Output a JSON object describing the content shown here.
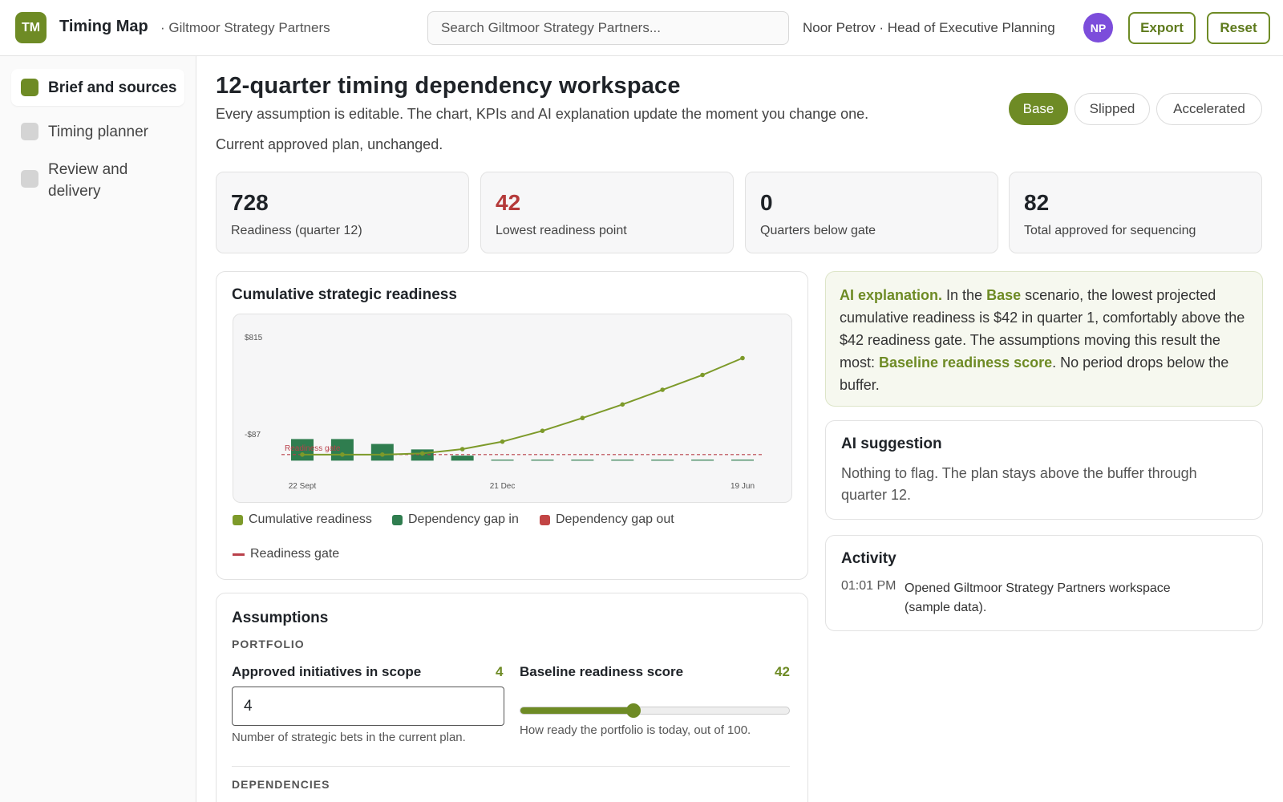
{
  "header": {
    "logo_text": "TM",
    "app_title": "Timing Map",
    "org_name": "· Giltmoor Strategy Partners",
    "search_placeholder": "Search Giltmoor Strategy Partners...",
    "user_label": "Noor Petrov · Head of Executive Planning",
    "avatar_initials": "NP",
    "export_label": "Export",
    "reset_label": "Reset"
  },
  "sidebar": {
    "items": [
      {
        "label": "Brief and sources",
        "active": true
      },
      {
        "label": "Timing planner",
        "active": false
      },
      {
        "label": "Review and delivery",
        "active": false
      }
    ]
  },
  "main": {
    "title": "12-quarter timing dependency workspace",
    "subtitle": "Every assumption is editable. The chart, KPIs and AI explanation update the moment you change one.",
    "scenario_description": "Current approved plan, unchanged.",
    "scenarios": [
      {
        "label": "Base",
        "active": true
      },
      {
        "label": "Slipped",
        "active": false
      },
      {
        "label": "Accelerated",
        "active": false
      }
    ]
  },
  "kpis": [
    {
      "value": "728",
      "label": "Readiness (quarter 12)",
      "status": "normal"
    },
    {
      "value": "42",
      "label": "Lowest readiness point",
      "status": "warning"
    },
    {
      "value": "0",
      "label": "Quarters below gate",
      "status": "normal"
    },
    {
      "value": "82",
      "label": "Total approved for sequencing",
      "status": "normal"
    }
  ],
  "chart_card": {
    "title": "Cumulative strategic readiness"
  },
  "chart_data": {
    "type": "line",
    "x_tick_labels": [
      "22 Sept",
      "21 Dec",
      "19 Jun"
    ],
    "y_tick_labels": [
      "$815",
      "-$87"
    ],
    "ylim": [
      -87,
      815
    ],
    "gate_label": "Readiness gate",
    "gate_value": 42,
    "series": [
      {
        "name": "Cumulative readiness",
        "type": "line",
        "values": [
          42,
          42,
          42,
          50,
          80,
          132,
          207,
          296,
          390,
          492,
          595,
          712
        ]
      },
      {
        "name": "Dependency gap in",
        "type": "bar",
        "values": [
          150,
          150,
          116,
          78,
          35,
          3,
          3,
          3,
          3,
          3,
          3,
          3
        ]
      },
      {
        "name": "Dependency gap out",
        "type": "bar",
        "values": [
          0,
          0,
          0,
          0,
          0,
          0,
          0,
          0,
          0,
          0,
          0,
          0
        ]
      }
    ],
    "colors": {
      "Cumulative readiness": "#7d9a2a",
      "Dependency gap in": "#2f7d4f",
      "Dependency gap out": "#c24545",
      "Readiness gate": "#b9404a"
    },
    "legend": [
      "Cumulative readiness",
      "Dependency gap in",
      "Dependency gap out",
      "Readiness gate"
    ],
    "legend_position": "bottom-left",
    "grid": false
  },
  "ai_explanation": {
    "lead": "AI explanation.",
    "text1": " In the ",
    "scenario": "Base",
    "text2": " scenario, the lowest projected cumulative readiness is $42 in quarter 1, comfortably above the $42 readiness gate. The assumptions moving this result the most: ",
    "driver": "Baseline readiness score",
    "text3": ". No period drops below the buffer."
  },
  "ai_suggestion": {
    "title": "AI suggestion",
    "text": "Nothing to flag. The plan stays above the buffer through quarter 12."
  },
  "activity": {
    "title": "Activity",
    "items": [
      {
        "time": "01:01 PM",
        "text": "Opened Giltmoor Strategy Partners workspace (sample data)."
      }
    ]
  },
  "assumptions": {
    "title": "Assumptions",
    "portfolio_label": "PORTFOLIO",
    "initiatives": {
      "label": "Approved initiatives in scope",
      "value_display": "4",
      "input_value": "4",
      "help": "Number of strategic bets in the current plan."
    },
    "baseline": {
      "label": "Baseline readiness score",
      "value_display": "42",
      "value": 42,
      "max": 100,
      "help": "How ready the portfolio is today, out of 100."
    },
    "dependencies_label": "DEPENDENCIES"
  }
}
